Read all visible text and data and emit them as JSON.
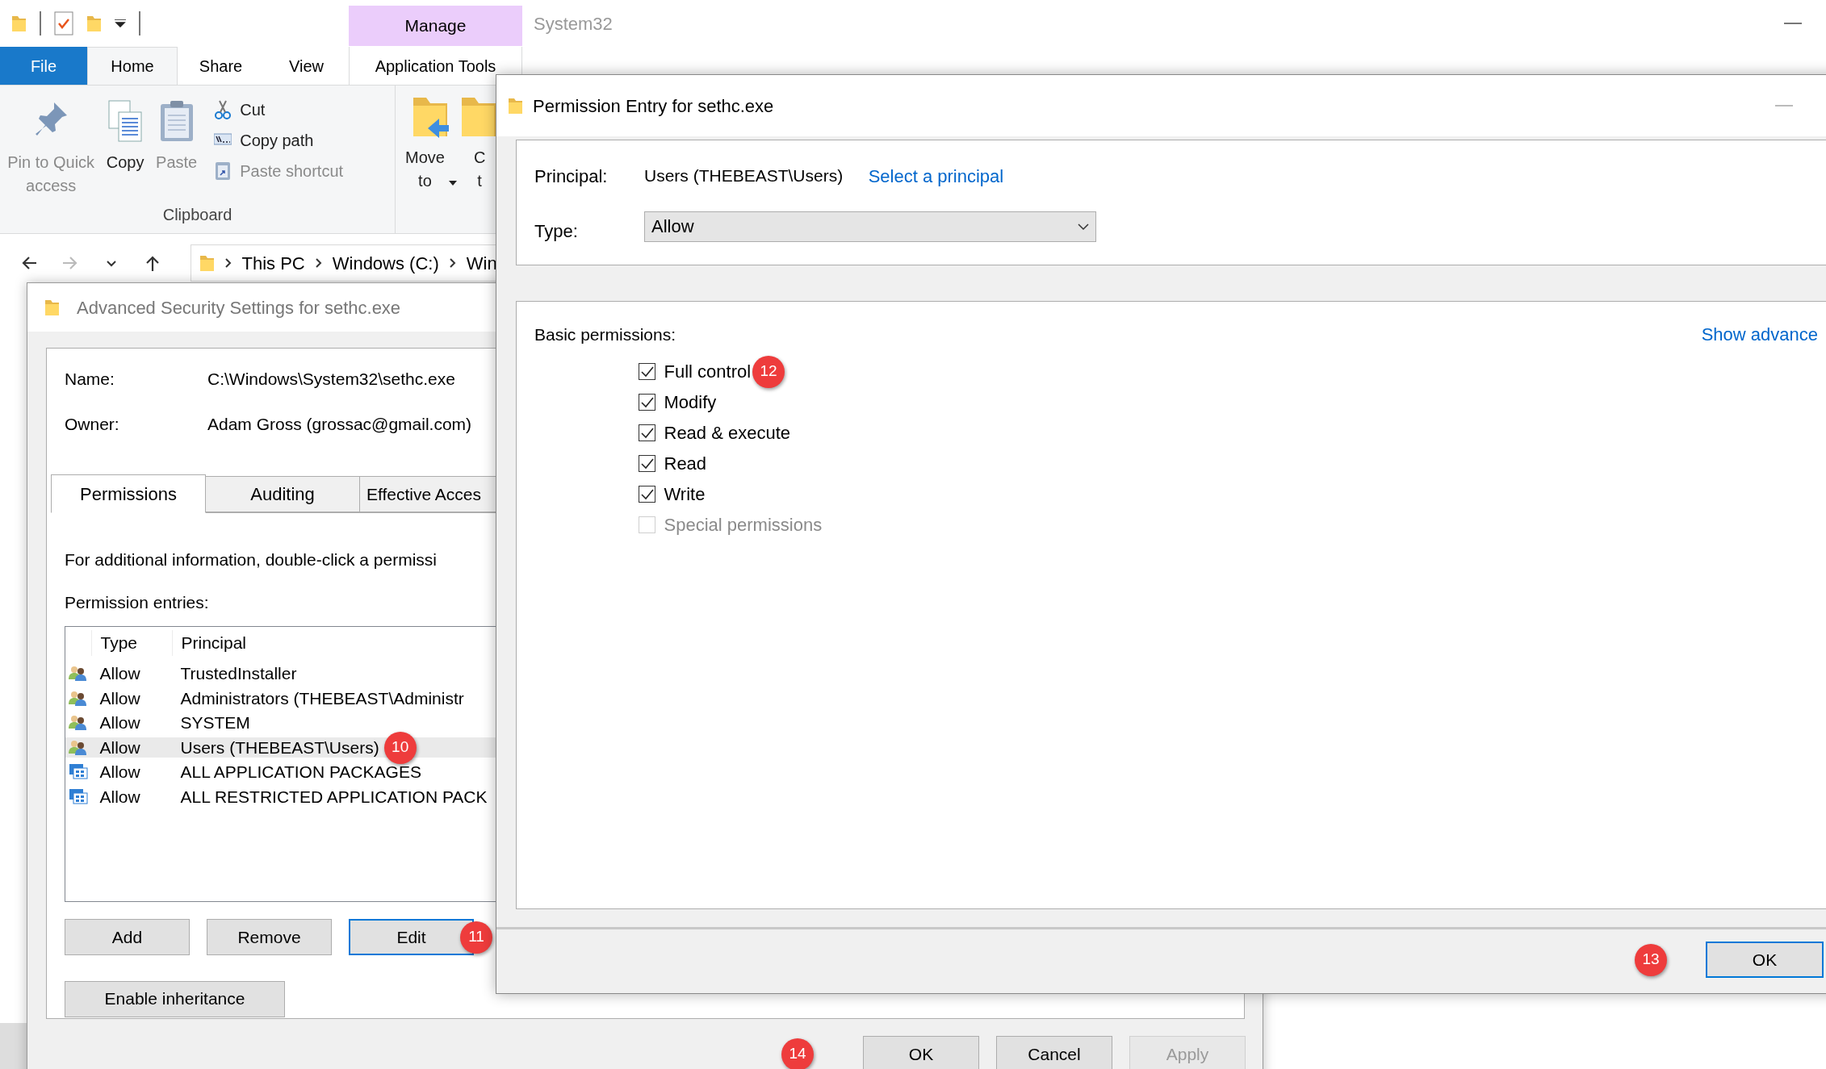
{
  "explorer": {
    "title": "System32",
    "contextual_header": "Manage",
    "ribbon_tabs": [
      {
        "label": "File",
        "kind": "file",
        "selected": false
      },
      {
        "label": "Home",
        "kind": "tab",
        "selected": true
      },
      {
        "label": "Share",
        "kind": "tab",
        "selected": false
      },
      {
        "label": "View",
        "kind": "tab",
        "selected": false
      },
      {
        "label": "Application Tools",
        "kind": "contextual",
        "selected": false
      }
    ],
    "clipboard": {
      "group_label": "Clipboard",
      "large": [
        {
          "lines": [
            "Pin to Quick",
            "access"
          ],
          "kind": "pin",
          "disabled": true
        },
        {
          "lines": [
            "Copy"
          ],
          "kind": "copy",
          "disabled": false
        },
        {
          "lines": [
            "Paste"
          ],
          "kind": "paste",
          "disabled": true
        }
      ],
      "small": [
        {
          "label": "Cut",
          "kind": "cut",
          "disabled": false
        },
        {
          "label": "Copy path",
          "kind": "path",
          "disabled": false
        },
        {
          "label": "Paste shortcut",
          "kind": "shortcut",
          "disabled": true
        }
      ]
    },
    "organize": [
      {
        "lines": [
          "Move",
          "to"
        ],
        "dropdown": true
      },
      {
        "lines": [
          "C",
          "t"
        ],
        "dropdown": false
      }
    ],
    "crumbs": [
      "This PC",
      "Windows (C:)",
      "Win"
    ]
  },
  "advanced": {
    "title": "Advanced Security Settings for sethc.exe",
    "fields": [
      {
        "label": "Name:",
        "value": "C:\\Windows\\System32\\sethc.exe"
      },
      {
        "label": "Owner:",
        "value": "Adam Gross (grossac@gmail.com)"
      }
    ],
    "tabs": [
      {
        "label": "Permissions",
        "selected": true
      },
      {
        "label": "Auditing",
        "selected": false
      },
      {
        "label": "Effective Acces",
        "selected": false
      }
    ],
    "info": "For additional information, double-click a permissi",
    "entries_label": "Permission entries:",
    "columns": [
      "Type",
      "Principal"
    ],
    "rows": [
      {
        "type": "Allow",
        "principal": "TrustedInstaller",
        "kind": "user",
        "selected": false
      },
      {
        "type": "Allow",
        "principal": "Administrators (THEBEAST\\Administr",
        "kind": "user",
        "selected": false
      },
      {
        "type": "Allow",
        "principal": "SYSTEM",
        "kind": "user",
        "selected": false
      },
      {
        "type": "Allow",
        "principal": "Users (THEBEAST\\Users)",
        "kind": "user",
        "selected": true,
        "callout": "10"
      },
      {
        "type": "Allow",
        "principal": "ALL APPLICATION PACKAGES",
        "kind": "package",
        "selected": false
      },
      {
        "type": "Allow",
        "principal": "ALL RESTRICTED APPLICATION PACK",
        "kind": "package",
        "selected": false
      }
    ],
    "buttons": [
      {
        "label": "Add",
        "focused": false
      },
      {
        "label": "Remove",
        "focused": false
      },
      {
        "label": "Edit",
        "focused": true,
        "callout": "11"
      }
    ],
    "inheritance_button": "Enable inheritance",
    "footer_callout": "14",
    "footer_buttons": [
      {
        "label": "OK",
        "disabled": false
      },
      {
        "label": "Cancel",
        "disabled": false
      },
      {
        "label": "Apply",
        "disabled": true
      }
    ]
  },
  "entry": {
    "title": "Permission Entry for sethc.exe",
    "principal_label": "Principal:",
    "principal_value": "Users (THEBEAST\\Users)",
    "select_link": "Select a principal",
    "type_label": "Type:",
    "type_value": "Allow",
    "basic_label": "Basic permissions:",
    "show_advanced": "Show advance",
    "permissions": [
      {
        "label": "Full control",
        "checked": true,
        "disabled": false,
        "callout": "12"
      },
      {
        "label": "Modify",
        "checked": true,
        "disabled": false
      },
      {
        "label": "Read & execute",
        "checked": true,
        "disabled": false
      },
      {
        "label": "Read",
        "checked": true,
        "disabled": false
      },
      {
        "label": "Write",
        "checked": true,
        "disabled": false
      },
      {
        "label": "Special permissions",
        "checked": false,
        "disabled": true
      }
    ],
    "ok_callout": "13",
    "ok_button": "OK"
  }
}
